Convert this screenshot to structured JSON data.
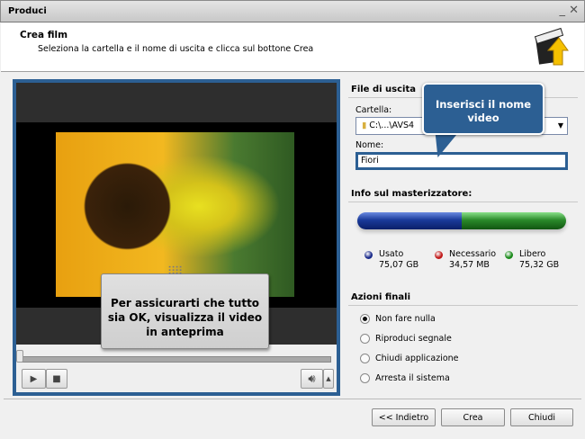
{
  "window": {
    "title": "Produci",
    "minimize": "_",
    "close": "✕"
  },
  "header": {
    "title": "Crea film",
    "subtitle": "Seleziona la cartella e il nome di uscita e clicca sul bottone Crea"
  },
  "preview": {
    "note": "Per assicurarti che tutto sia OK, visualizza il video in anteprima",
    "progress": 0
  },
  "output": {
    "section": "File di uscita",
    "folder_label": "Cartella:",
    "folder_value": "C:\\...\\AVS4",
    "name_label": "Nome:",
    "name_value": "Fiori",
    "callout": "Inserisci il nome video"
  },
  "burner": {
    "section": "Info sul masterizzatore:",
    "used_fraction": 0.5,
    "legend": [
      {
        "label": "Usato",
        "value": "75,07 GB",
        "color": "#1a2a8a"
      },
      {
        "label": "Necessario",
        "value": "34,57 MB",
        "color": "#c01818"
      },
      {
        "label": "Libero",
        "value": "75,32 GB",
        "color": "#1a8a1a"
      }
    ]
  },
  "actions": {
    "section": "Azioni finali",
    "options": [
      {
        "label": "Non fare nulla",
        "selected": true
      },
      {
        "label": "Riproduci segnale",
        "selected": false
      },
      {
        "label": "Chiudi applicazione",
        "selected": false
      },
      {
        "label": "Arresta il sistema",
        "selected": false
      }
    ]
  },
  "buttons": {
    "back": "<< Indietro",
    "create": "Crea",
    "close": "Chiudi"
  }
}
